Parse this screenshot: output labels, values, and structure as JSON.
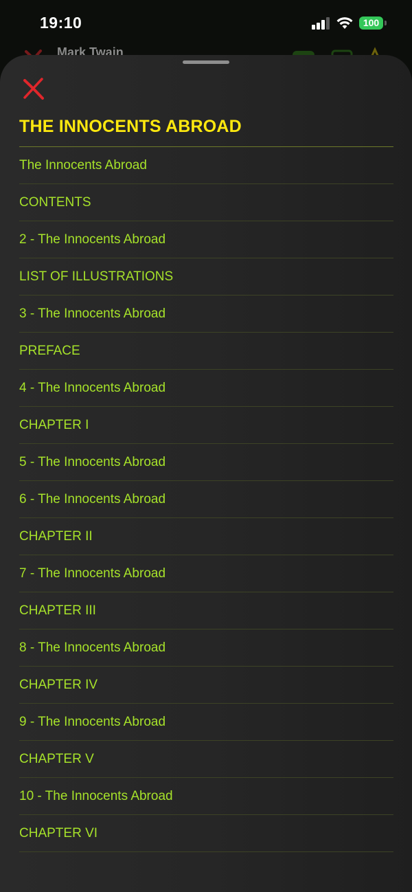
{
  "status_bar": {
    "time": "19:10",
    "battery": "100"
  },
  "background_header": {
    "title": "Mark Twain"
  },
  "sheet": {
    "title": "THE INNOCENTS ABROAD"
  },
  "toc": [
    {
      "label": "The Innocents Abroad"
    },
    {
      "label": "CONTENTS"
    },
    {
      "label": "2 - The Innocents Abroad"
    },
    {
      "label": "LIST OF ILLUSTRATIONS"
    },
    {
      "label": "3 - The Innocents Abroad"
    },
    {
      "label": "PREFACE"
    },
    {
      "label": "4 - The Innocents Abroad"
    },
    {
      "label": "CHAPTER I"
    },
    {
      "label": "5 - The Innocents Abroad"
    },
    {
      "label": "6 - The Innocents Abroad"
    },
    {
      "label": "CHAPTER II"
    },
    {
      "label": "7 - The Innocents Abroad"
    },
    {
      "label": "CHAPTER III"
    },
    {
      "label": "8 - The Innocents Abroad"
    },
    {
      "label": "CHAPTER IV"
    },
    {
      "label": "9 - The Innocents Abroad"
    },
    {
      "label": "CHAPTER V"
    },
    {
      "label": "10 - The Innocents Abroad"
    },
    {
      "label": "CHAPTER VI"
    }
  ],
  "colors": {
    "title": "#fde80f",
    "link": "#a6e22a",
    "close": "#e0262b",
    "battery": "#34c759"
  },
  "icons": {
    "close": "close-icon",
    "signal": "cellular-signal-icon",
    "wifi": "wifi-icon",
    "battery": "battery-icon"
  }
}
